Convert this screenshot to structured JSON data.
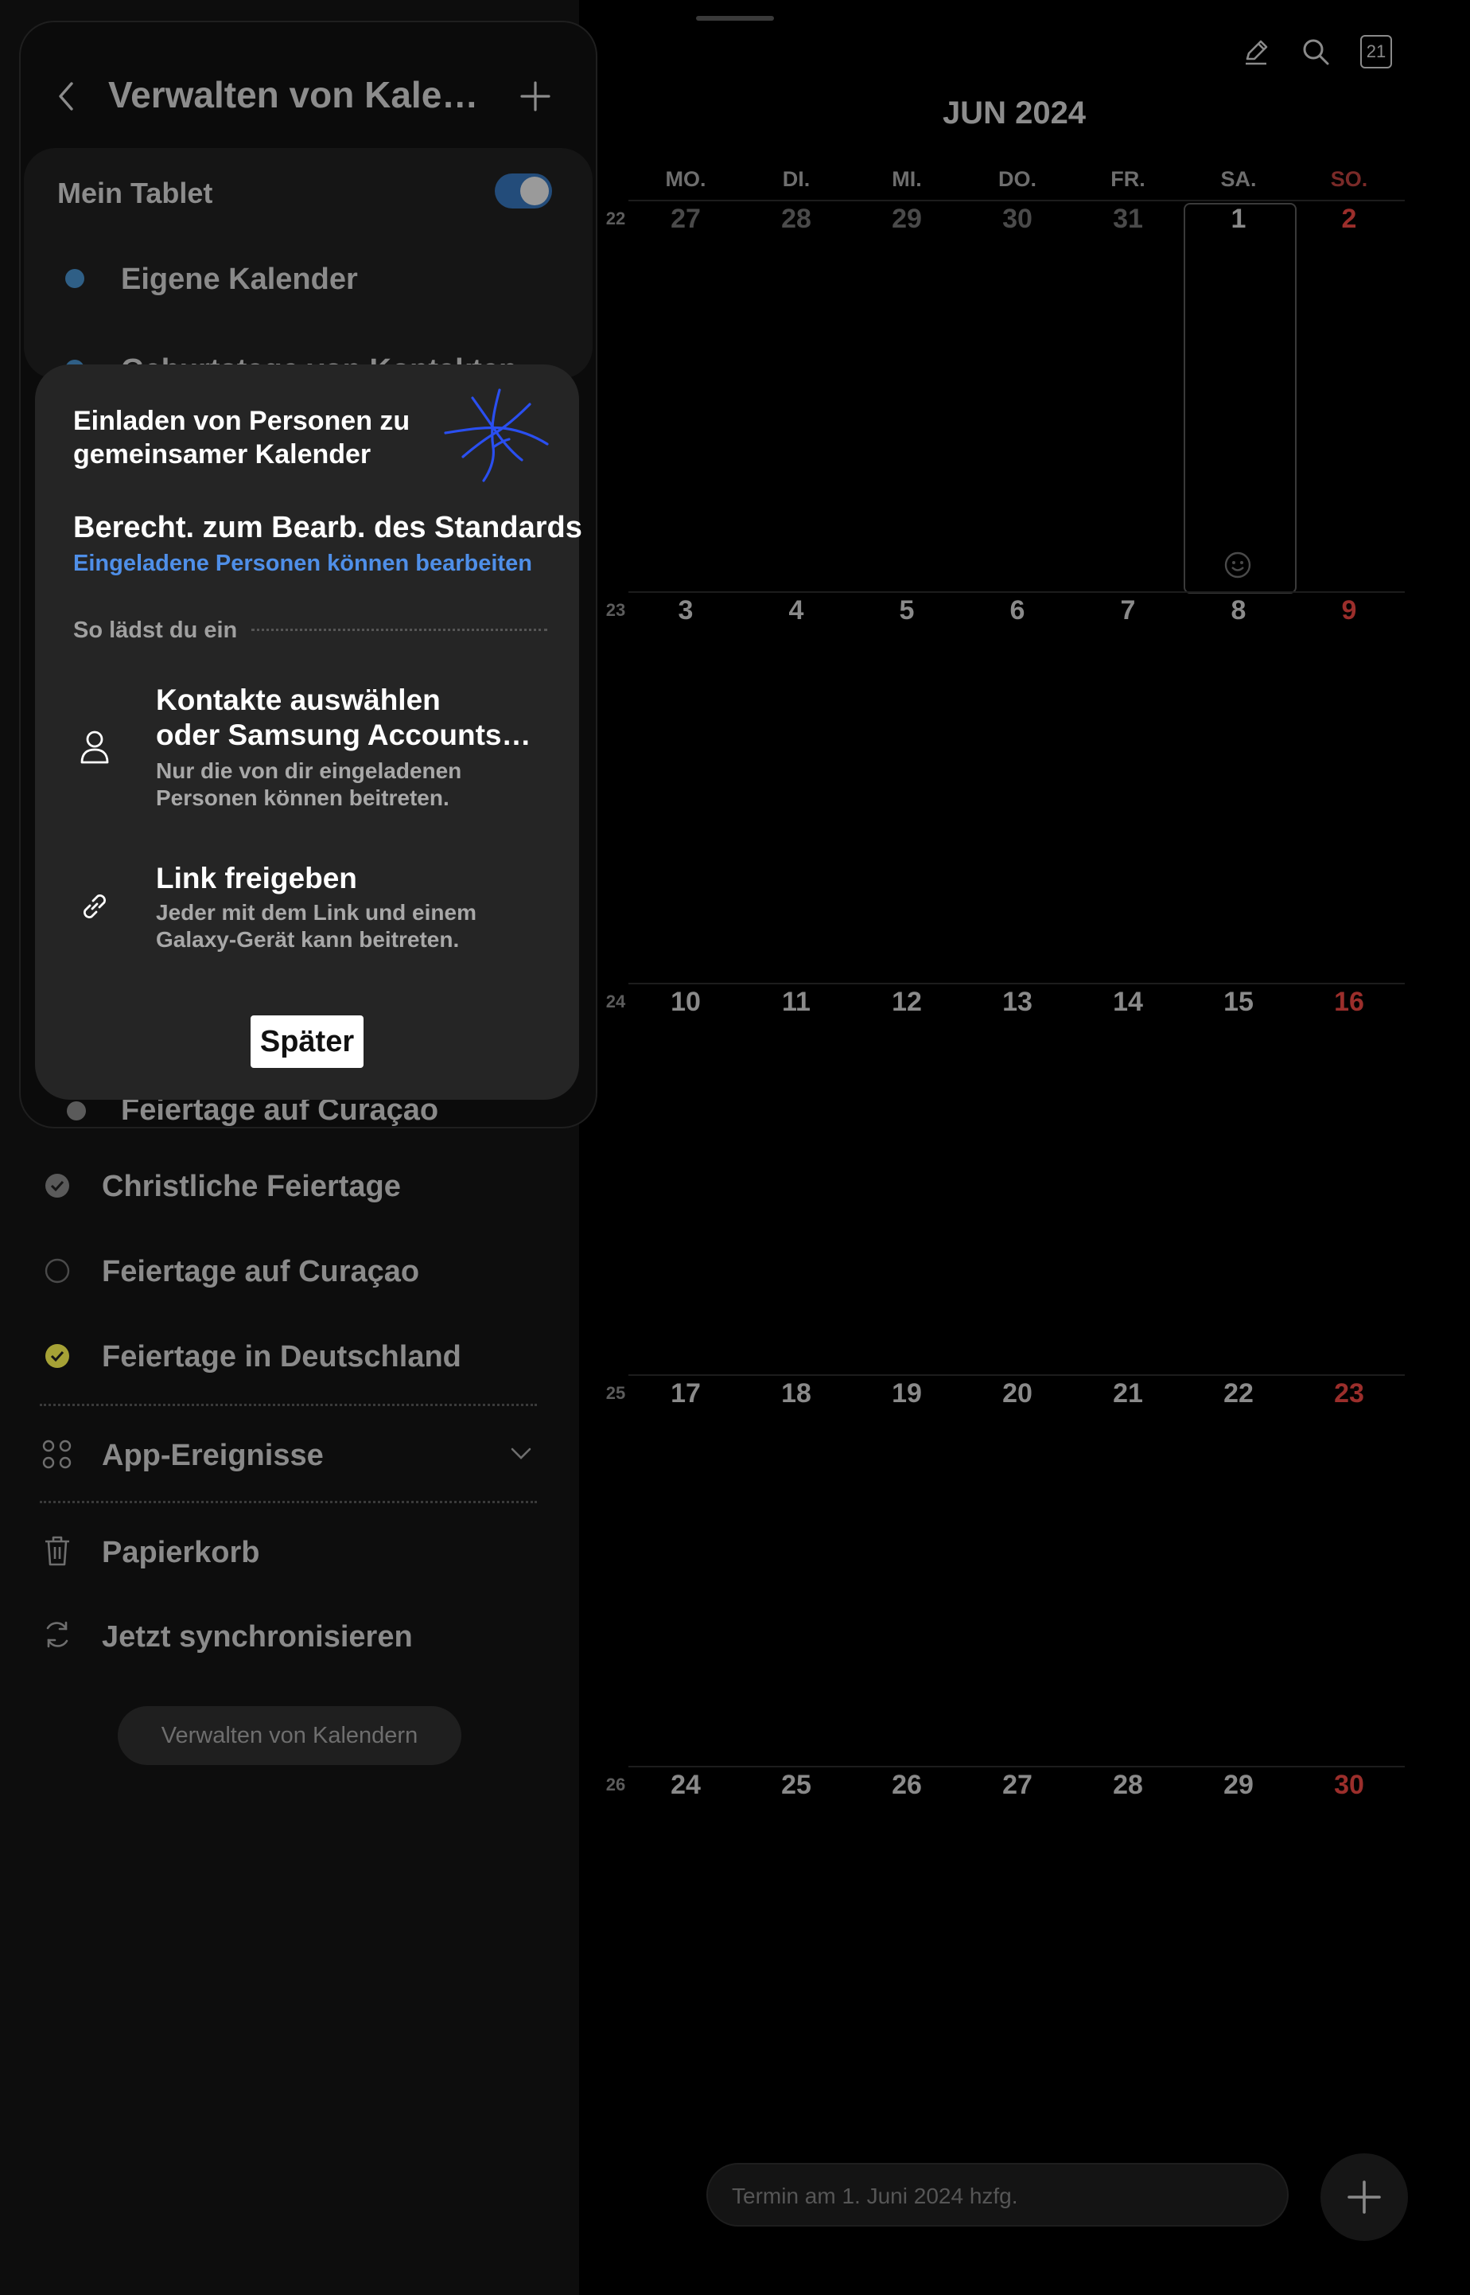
{
  "top_icons": {
    "edit": "pencil-icon",
    "search": "search-icon",
    "today_badge": "21"
  },
  "calendar": {
    "month_title": "JUN 2024",
    "weekdays": [
      "MO.",
      "DI.",
      "MI.",
      "DO.",
      "FR.",
      "SA.",
      "SO."
    ],
    "weeks": [
      {
        "number": "22",
        "days": [
          "27",
          "28",
          "29",
          "30",
          "31",
          "1",
          "2"
        ]
      },
      {
        "number": "23",
        "days": [
          "3",
          "4",
          "5",
          "6",
          "7",
          "8",
          "9"
        ]
      },
      {
        "number": "24",
        "days": [
          "10",
          "11",
          "12",
          "13",
          "14",
          "15",
          "16"
        ]
      },
      {
        "number": "25",
        "days": [
          "17",
          "18",
          "19",
          "20",
          "21",
          "22",
          "23"
        ]
      },
      {
        "number": "26",
        "days": [
          "24",
          "25",
          "26",
          "27",
          "28",
          "29",
          "30"
        ]
      }
    ],
    "today_emoji": "smiley-icon"
  },
  "sidebar": {
    "title": "Verwalten von Kalendern",
    "group_label": "Mein Tablet",
    "items": [
      {
        "label": "Eigene Kalender",
        "dot_color": "#2f5f86"
      },
      {
        "label": "Geburtstage von Kontakten",
        "dot_color": "#2f5f86"
      },
      {
        "label": "Feiertage auf Curaçao",
        "dot_color": "#6a6a6a"
      }
    ],
    "holidays": [
      {
        "label": "Christliche Feiertage",
        "checked": true,
        "color": "#6a6a6a"
      },
      {
        "label": "Feiertage auf Curaçao",
        "checked": false,
        "color": "#6a6a6a"
      },
      {
        "label": "Feiertage in Deutschland",
        "checked": true,
        "color": "#a6a236"
      }
    ],
    "app_events": "App-Ereignisse",
    "trash": "Papierkorb",
    "sync": "Jetzt synchronisieren",
    "manage_button": "Verwalten von Kalendern"
  },
  "dialog": {
    "title": "Einladen von Personen zu gemeinsamer Kalender",
    "permission_title": "Berecht. zum Bearb. des Standards",
    "permission_value": "Eingeladene Personen können bearbeiten",
    "how_label": "So lädst du ein",
    "option1_title_1": "Kontakte auswählen",
    "option1_title_2": "oder Samsung Accounts hinzufügen",
    "option1_desc": "Nur die von dir eingeladenen Personen können beitreten.",
    "option2_title": "Link freigeben",
    "option2_desc": "Jeder mit dem Link und einem Galaxy-Gerät kann beitreten.",
    "later_button": "Später",
    "accent": "#4f8fe8"
  },
  "bottom": {
    "quick_add_placeholder": "Termin am 1. Juni 2024 hzfg."
  }
}
